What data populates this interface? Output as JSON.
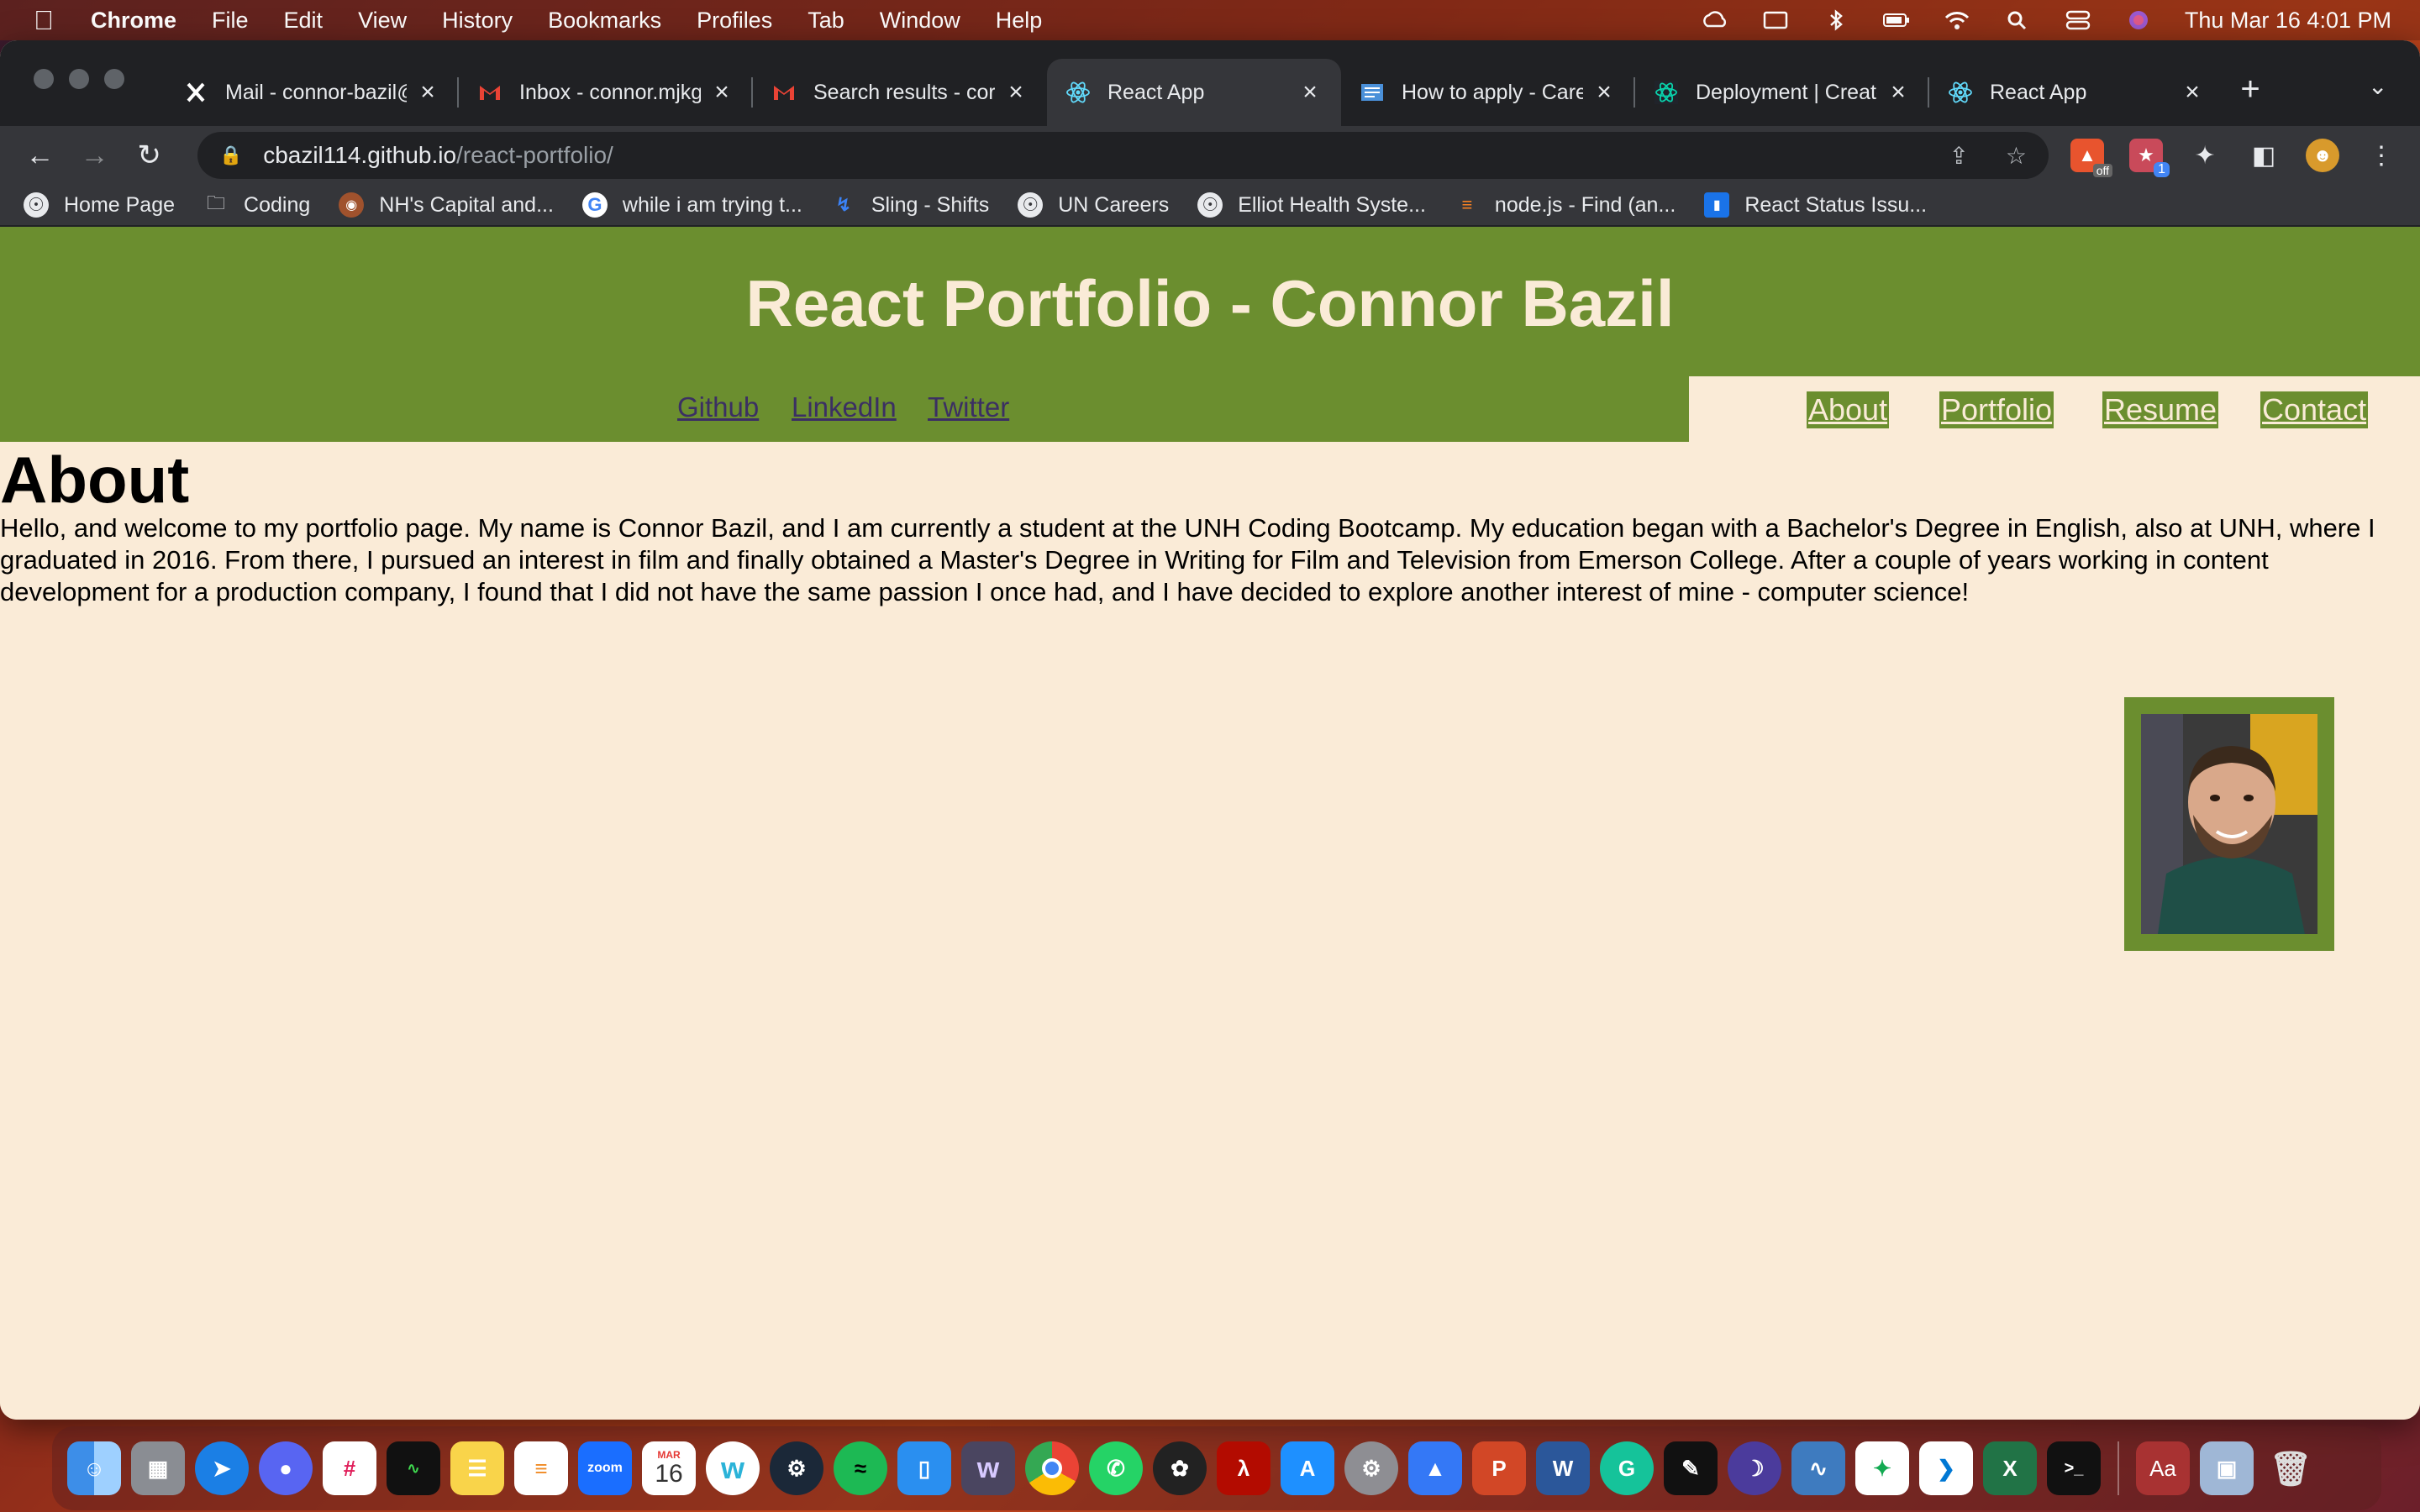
{
  "menubar": {
    "app": "Chrome",
    "items": [
      "File",
      "Edit",
      "View",
      "History",
      "Bookmarks",
      "Profiles",
      "Tab",
      "Window",
      "Help"
    ],
    "clock": "Thu Mar 16  4:01 PM"
  },
  "tabs": [
    {
      "title": "Mail - connor-bazil@",
      "favicon": "x-icon"
    },
    {
      "title": "Inbox - connor.mjkg",
      "favicon": "gmail-icon"
    },
    {
      "title": "Search results - cor",
      "favicon": "gmail-icon"
    },
    {
      "title": "React App",
      "favicon": "react-icon",
      "active": true
    },
    {
      "title": "How to apply - Care",
      "favicon": "un-icon"
    },
    {
      "title": "Deployment | Create",
      "favicon": "react-icon"
    },
    {
      "title": "React App",
      "favicon": "react-icon"
    }
  ],
  "address": {
    "host": "cbazil114.github.io",
    "path": "/react-portfolio/"
  },
  "bookmarks": [
    {
      "label": "Home Page",
      "icon": "globe-icon"
    },
    {
      "label": "Coding",
      "icon": "folder-icon"
    },
    {
      "label": "NH's Capital and...",
      "icon": "site-icon"
    },
    {
      "label": "while i am trying t...",
      "icon": "google-icon"
    },
    {
      "label": "Sling - Shifts",
      "icon": "sling-icon"
    },
    {
      "label": "UN Careers",
      "icon": "globe-icon"
    },
    {
      "label": "Elliot Health Syste...",
      "icon": "globe-icon"
    },
    {
      "label": "node.js - Find (an...",
      "icon": "stackoverflow-icon"
    },
    {
      "label": "React Status Issu...",
      "icon": "chat-icon"
    }
  ],
  "page": {
    "title": "React Portfolio - Connor Bazil",
    "social": [
      "Github",
      "LinkedIn",
      "Twitter"
    ],
    "nav": [
      "About",
      "Portfolio",
      "Resume",
      "Contact"
    ],
    "section_title": "About",
    "about_text": "Hello, and welcome to my portfolio page. My name is Connor Bazil, and I am currently a student at the UNH Coding Bootcamp. My education began with a Bachelor's Degree in English, also at UNH, where I graduated in 2016. From there, I pursued an interest in film and finally obtained a Master's Degree in Writing for Film and Television from Emerson College. After a couple of years working in content development for a production company, I found that I did not have the same passion I once had, and I have decided to explore another interest of mine - computer science!"
  },
  "dock": {
    "calendar_month": "MAR",
    "calendar_day": "16"
  },
  "colors": {
    "header_green": "#6b8e2f",
    "page_bg": "#faebd7"
  }
}
